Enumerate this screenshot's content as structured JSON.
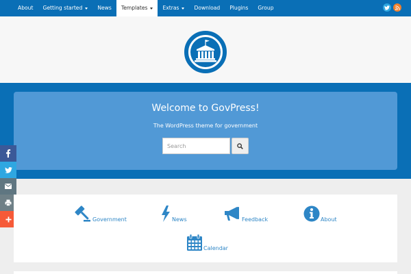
{
  "nav": {
    "items": [
      {
        "label": "About",
        "dropdown": false,
        "active": false
      },
      {
        "label": "Getting started",
        "dropdown": true,
        "active": false
      },
      {
        "label": "News",
        "dropdown": false,
        "active": false
      },
      {
        "label": "Templates",
        "dropdown": true,
        "active": true
      },
      {
        "label": "Extras",
        "dropdown": true,
        "active": false
      },
      {
        "label": "Download",
        "dropdown": false,
        "active": false
      },
      {
        "label": "Plugins",
        "dropdown": false,
        "active": false
      },
      {
        "label": "Group",
        "dropdown": false,
        "active": false
      }
    ],
    "social": [
      "twitter-icon",
      "rss-icon"
    ]
  },
  "logo": {
    "icon": "capitol-building-icon"
  },
  "hero": {
    "title": "Welcome to GovPress!",
    "subtitle": "The WordPress theme for government",
    "search_placeholder": "Search"
  },
  "share": [
    "facebook-icon",
    "twitter-icon",
    "email-icon",
    "print-icon",
    "plus-icon"
  ],
  "features": [
    {
      "label": "Government",
      "icon": "gavel-icon"
    },
    {
      "label": "News",
      "icon": "lightning-bolt-icon"
    },
    {
      "label": "Feedback",
      "icon": "megaphone-icon"
    },
    {
      "label": "About",
      "icon": "info-icon"
    },
    {
      "label": "Calendar",
      "icon": "calendar-icon"
    }
  ],
  "colors": {
    "primary": "#0a6fb6",
    "hero_panel": "#5199d6",
    "link": "#2e86c6",
    "facebook": "#3b5998",
    "twitter": "#2fa7e1",
    "email": "#5f7681",
    "print": "#6f8087",
    "plus": "#f65a38",
    "rss": "#f0802c"
  }
}
